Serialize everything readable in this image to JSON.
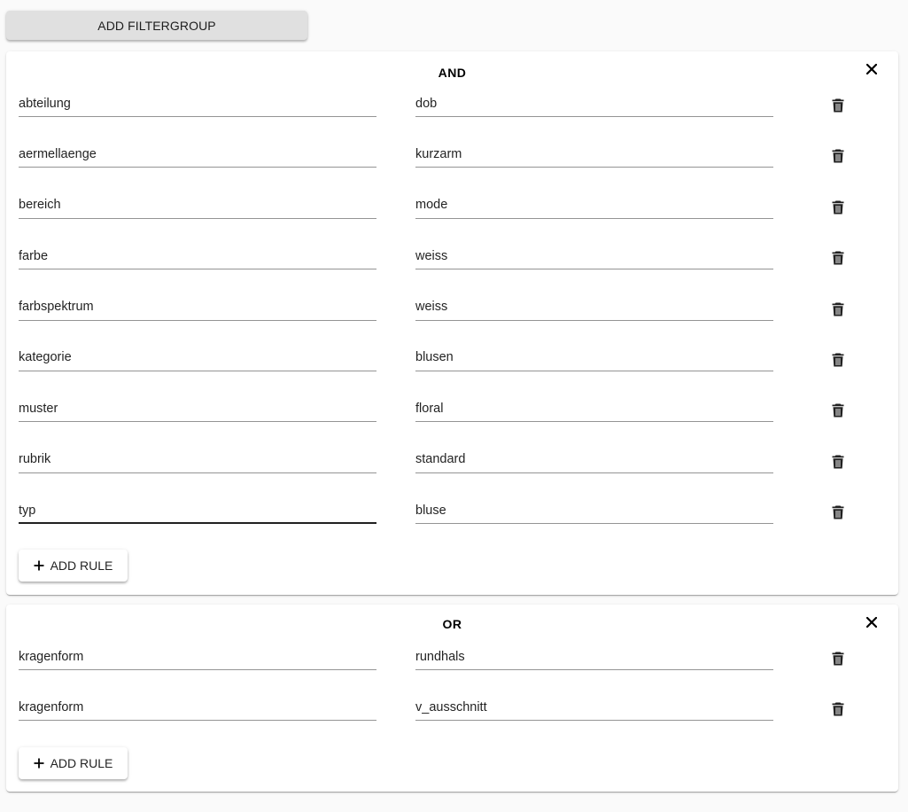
{
  "toolbar": {
    "add_filtergroup_label": "ADD FILTERGROUP"
  },
  "icons": {
    "close": "close-icon",
    "delete": "trash-icon",
    "add": "plus-icon"
  },
  "groups": [
    {
      "operator": "AND",
      "add_rule_label": "ADD RULE",
      "rules": [
        {
          "key": "abteilung",
          "value": "dob"
        },
        {
          "key": "aermellaenge",
          "value": "kurzarm"
        },
        {
          "key": "bereich",
          "value": "mode"
        },
        {
          "key": "farbe",
          "value": "weiss"
        },
        {
          "key": "farbspektrum",
          "value": "weiss"
        },
        {
          "key": "kategorie",
          "value": "blusen"
        },
        {
          "key": "muster",
          "value": "floral"
        },
        {
          "key": "rubrik",
          "value": "standard"
        },
        {
          "key": "typ",
          "value": "bluse",
          "active": true
        }
      ]
    },
    {
      "operator": "OR",
      "add_rule_label": "ADD RULE",
      "rules": [
        {
          "key": "kragenform",
          "value": "rundhals"
        },
        {
          "key": "kragenform",
          "value": "v_ausschnitt"
        }
      ]
    }
  ]
}
